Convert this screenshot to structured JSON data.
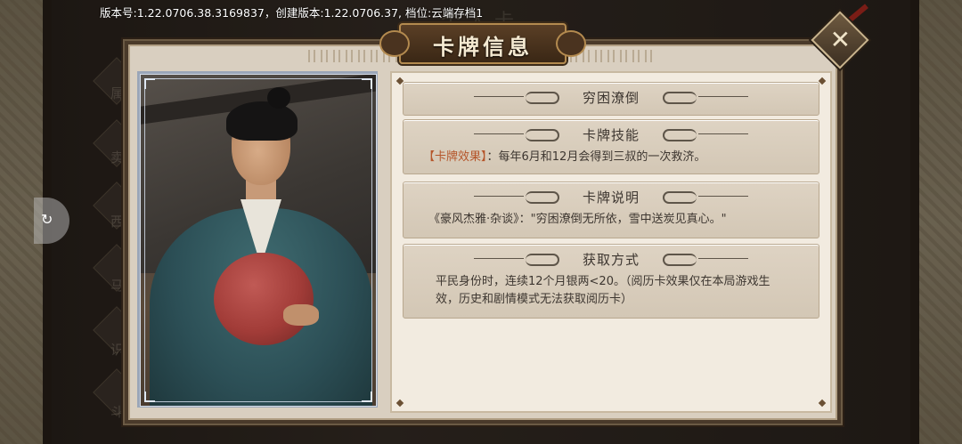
{
  "version_bar": "版本号:1.22.0706.38.3169837，创建版本:1.22.0706.37, 档位:云端存档1",
  "background": {
    "title": "个人卡",
    "menu_chars": [
      "属",
      "卖",
      "西",
      "马",
      "识",
      "斗"
    ]
  },
  "dialog": {
    "title": "卡牌信息",
    "close_label": "✕",
    "card_name": "穷困潦倒",
    "sections": [
      {
        "heading": "卡牌技能",
        "tag": "【卡牌效果】",
        "text": "：每年6月和12月会得到三叔的一次救济。"
      },
      {
        "heading": "卡牌说明",
        "text": "《豪风杰雅·杂谈》：\"穷困潦倒无所依，雪中送炭见真心。\""
      },
      {
        "heading": "获取方式",
        "text": "平民身份时，连续12个月银两<20。（阅历卡效果仅在本局游戏生效，历史和剧情模式无法获取阅历卡）"
      }
    ]
  },
  "float_button_label": "↻",
  "colors": {
    "dialog_frame": "#4a3a2a",
    "panel_bg": "#f2ebe0",
    "card_bg": "#d8cdbc",
    "tag": "#b5552a",
    "title_plaque": "#4a331f"
  },
  "icons": [
    "close-icon",
    "refresh-icon"
  ]
}
